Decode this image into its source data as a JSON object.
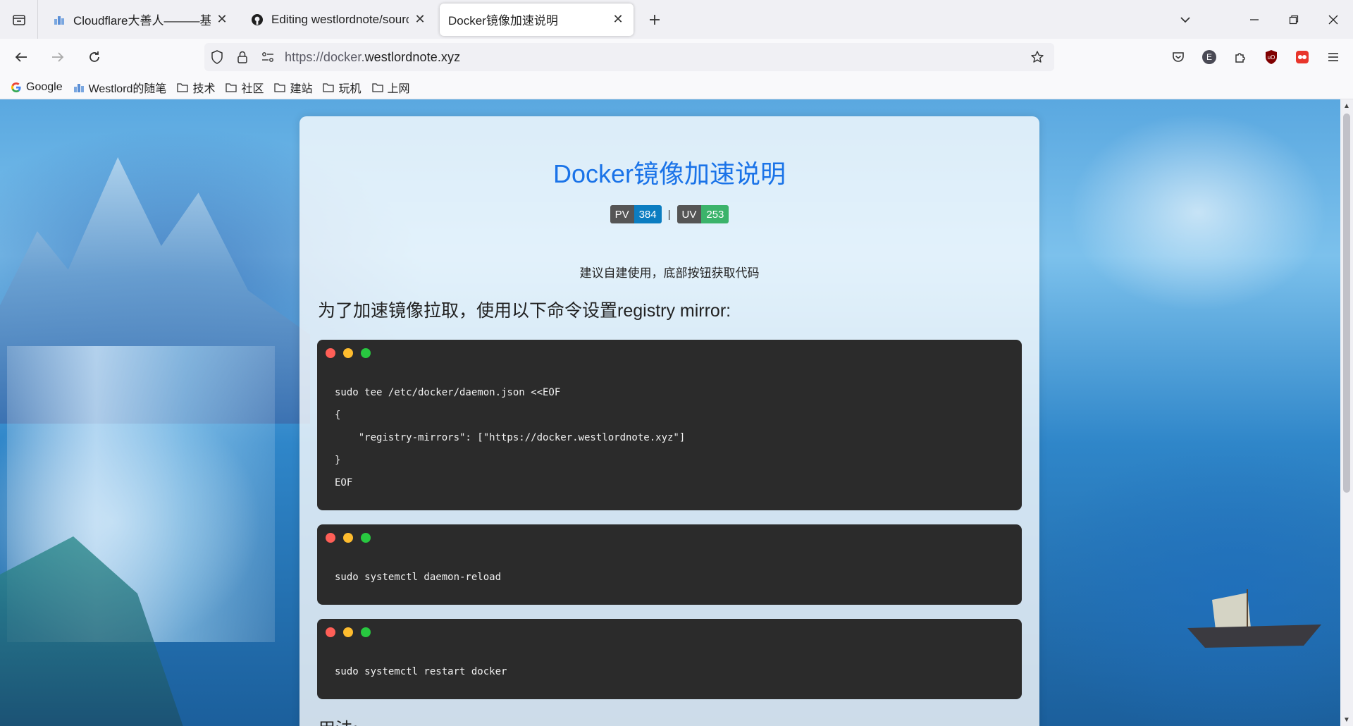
{
  "browser": {
    "tabs": [
      {
        "title": "Cloudflare大善人———基于C",
        "active": false
      },
      {
        "title": "Editing westlordnote/source",
        "active": false
      },
      {
        "title": "Docker镜像加速说明",
        "active": true
      }
    ],
    "url": {
      "scheme": "https://",
      "sub": "docker.",
      "host": "westlordnote.xyz"
    },
    "bookmarks": [
      {
        "label": "Google",
        "icon": "google-icon"
      },
      {
        "label": "Westlord的随笔",
        "icon": "site-icon"
      },
      {
        "label": "技术",
        "icon": "folder-icon"
      },
      {
        "label": "社区",
        "icon": "folder-icon"
      },
      {
        "label": "建站",
        "icon": "folder-icon"
      },
      {
        "label": "玩机",
        "icon": "folder-icon"
      },
      {
        "label": "上网",
        "icon": "folder-icon"
      }
    ],
    "extension_badge": "E"
  },
  "page": {
    "title": "Docker镜像加速说明",
    "stats": {
      "pv_label": "PV",
      "pv_value": "384",
      "separator": "|",
      "uv_label": "UV",
      "uv_value": "253"
    },
    "tip": "建议自建使用，底部按钮获取代码",
    "heading1": "为了加速镜像拉取，使用以下命令设置registry mirror:",
    "code_blocks": [
      {
        "lines": [
          "sudo tee /etc/docker/daemon.json <<EOF",
          "{",
          "    \"registry-mirrors\": [\"https://docker.westlordnote.xyz\"]",
          "}",
          "EOF"
        ]
      },
      {
        "lines": [
          "sudo systemctl daemon-reload"
        ]
      },
      {
        "lines": [
          "sudo systemctl restart docker"
        ]
      }
    ],
    "heading2": "用法:"
  },
  "colors": {
    "title": "#1a73e8",
    "code_bg": "#2b2b2b",
    "pv": "#0b7dc1",
    "uv": "#3bb36a"
  }
}
